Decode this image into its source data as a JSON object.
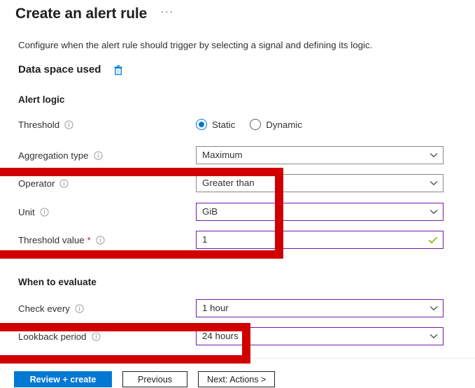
{
  "header": {
    "title": "Create an alert rule",
    "overflow_menu": "···"
  },
  "description": "Configure when the alert rule should trigger by selecting a signal and defining its logic.",
  "signal": {
    "name": "Data space used",
    "delete_icon": "trash-icon"
  },
  "alert_logic": {
    "section_title": "Alert logic",
    "threshold": {
      "label": "Threshold",
      "info_icon": "info-icon",
      "options": [
        {
          "label": "Static",
          "selected": true
        },
        {
          "label": "Dynamic",
          "selected": false
        }
      ]
    },
    "aggregation_type": {
      "label": "Aggregation type",
      "info_icon": "info-icon",
      "value": "Maximum",
      "chevron_icon": "chevron-down-icon"
    },
    "operator": {
      "label": "Operator",
      "info_icon": "info-icon",
      "value": "Greater than",
      "chevron_icon": "chevron-down-icon"
    },
    "unit": {
      "label": "Unit",
      "info_icon": "info-icon",
      "value": "GiB",
      "chevron_icon": "chevron-down-icon"
    },
    "threshold_value": {
      "label": "Threshold value",
      "required_marker": "*",
      "info_icon": "info-icon",
      "value": "1",
      "valid_icon": "check-icon"
    }
  },
  "when_to_evaluate": {
    "section_title": "When to evaluate",
    "check_every": {
      "label": "Check every",
      "info_icon": "info-icon",
      "value": "1 hour",
      "chevron_icon": "chevron-down-icon"
    },
    "lookback_period": {
      "label": "Lookback period",
      "info_icon": "info-icon",
      "value": "24 hours",
      "chevron_icon": "chevron-down-icon"
    }
  },
  "footer": {
    "review_create_label": "Review + create",
    "previous_label": "Previous",
    "next_label": "Next: Actions >"
  },
  "annotations": [
    {
      "name": "operator-unit-threshold-highlight",
      "color": "#d10000"
    },
    {
      "name": "lookback-period-highlight",
      "color": "#d10000"
    }
  ],
  "colors": {
    "primary": "#0078d4",
    "annotation": "#d10000",
    "field_modified_border": "#7719aa",
    "valid_check": "#7fba00",
    "required": "#a4262c"
  }
}
